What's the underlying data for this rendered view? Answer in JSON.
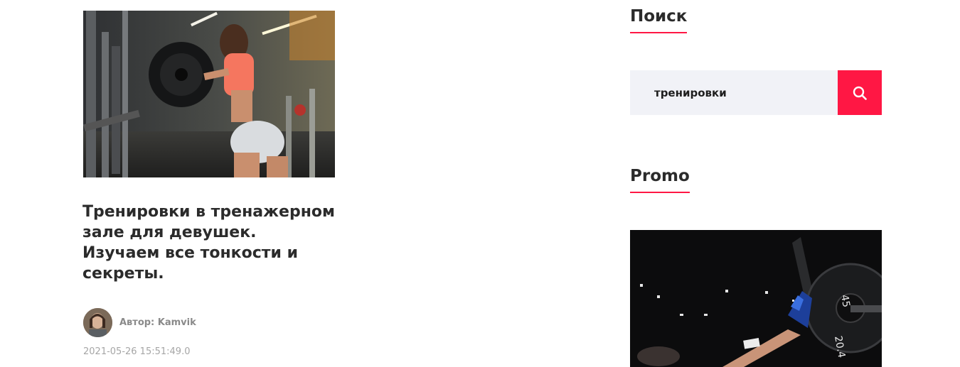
{
  "article": {
    "title": "Тренировки в тренажерном зале для девушек. Изучаем все тонкости и секреты.",
    "author_label": "Автор: Kamvik",
    "date": "2021-05-26 15:51:49.0"
  },
  "sidebar": {
    "search": {
      "title": "Поиск",
      "value": "тренировки"
    },
    "promo": {
      "title": "Promo",
      "plate_labels": [
        "45",
        "20.4"
      ]
    }
  },
  "colors": {
    "accent": "#ff1744",
    "search_bg": "#f1f2f7",
    "title": "#2b2b2b",
    "meta": "#8a8a8a"
  },
  "icons": {
    "search_button": "search-icon"
  }
}
